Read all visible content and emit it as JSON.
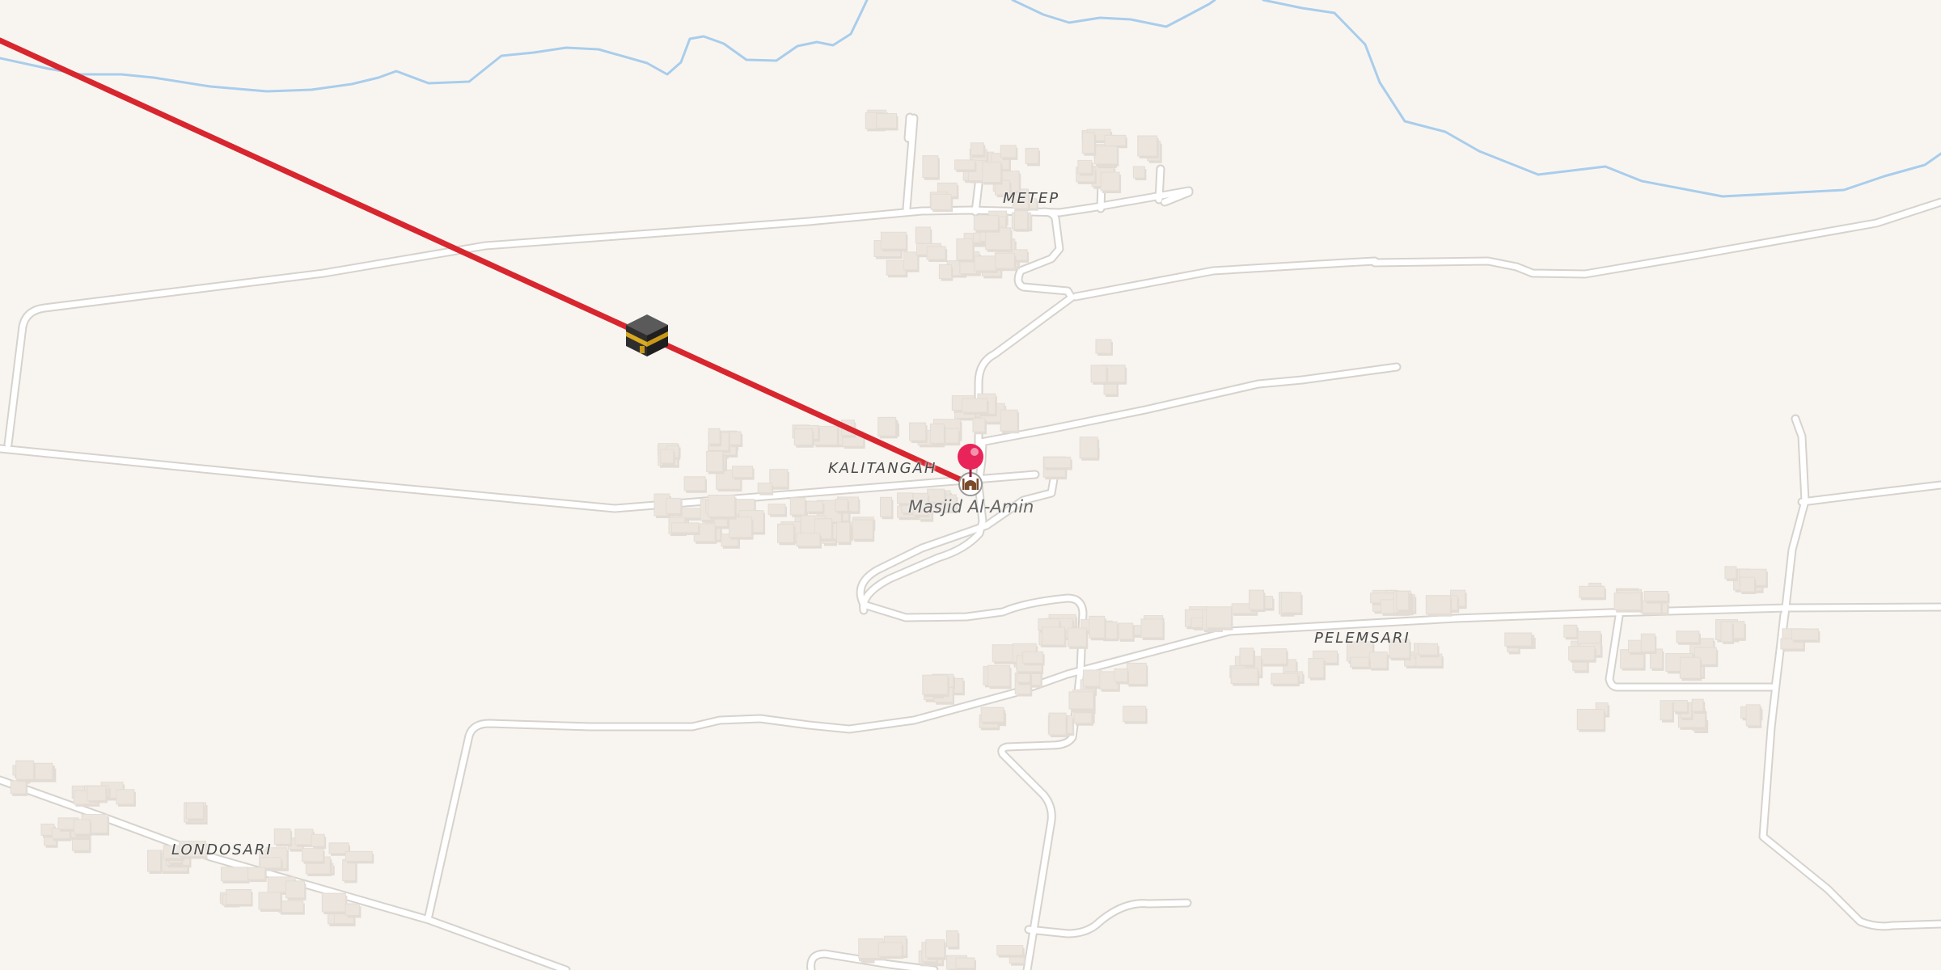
{
  "map": {
    "places": [
      {
        "id": "metep",
        "name": "METEP"
      },
      {
        "id": "kalitangah",
        "name": "KALITANGAH"
      },
      {
        "id": "pelemsari",
        "name": "PELEMSARI"
      },
      {
        "id": "londosari",
        "name": "LONDOSARI"
      }
    ],
    "poi": {
      "name": "Masjid Al-Amin",
      "icon": "mosque-icon"
    },
    "qibla": {
      "icon": "kaaba-icon",
      "line_color": "#d8262f"
    },
    "marker": {
      "icon": "map-pin-icon",
      "color": "#e8245a"
    },
    "colors": {
      "background": "#f8f5f1",
      "water": "#a9cdeb",
      "road": "#ffffff",
      "road_casing": "#d6d2cc",
      "building": "#ebe5de"
    }
  }
}
